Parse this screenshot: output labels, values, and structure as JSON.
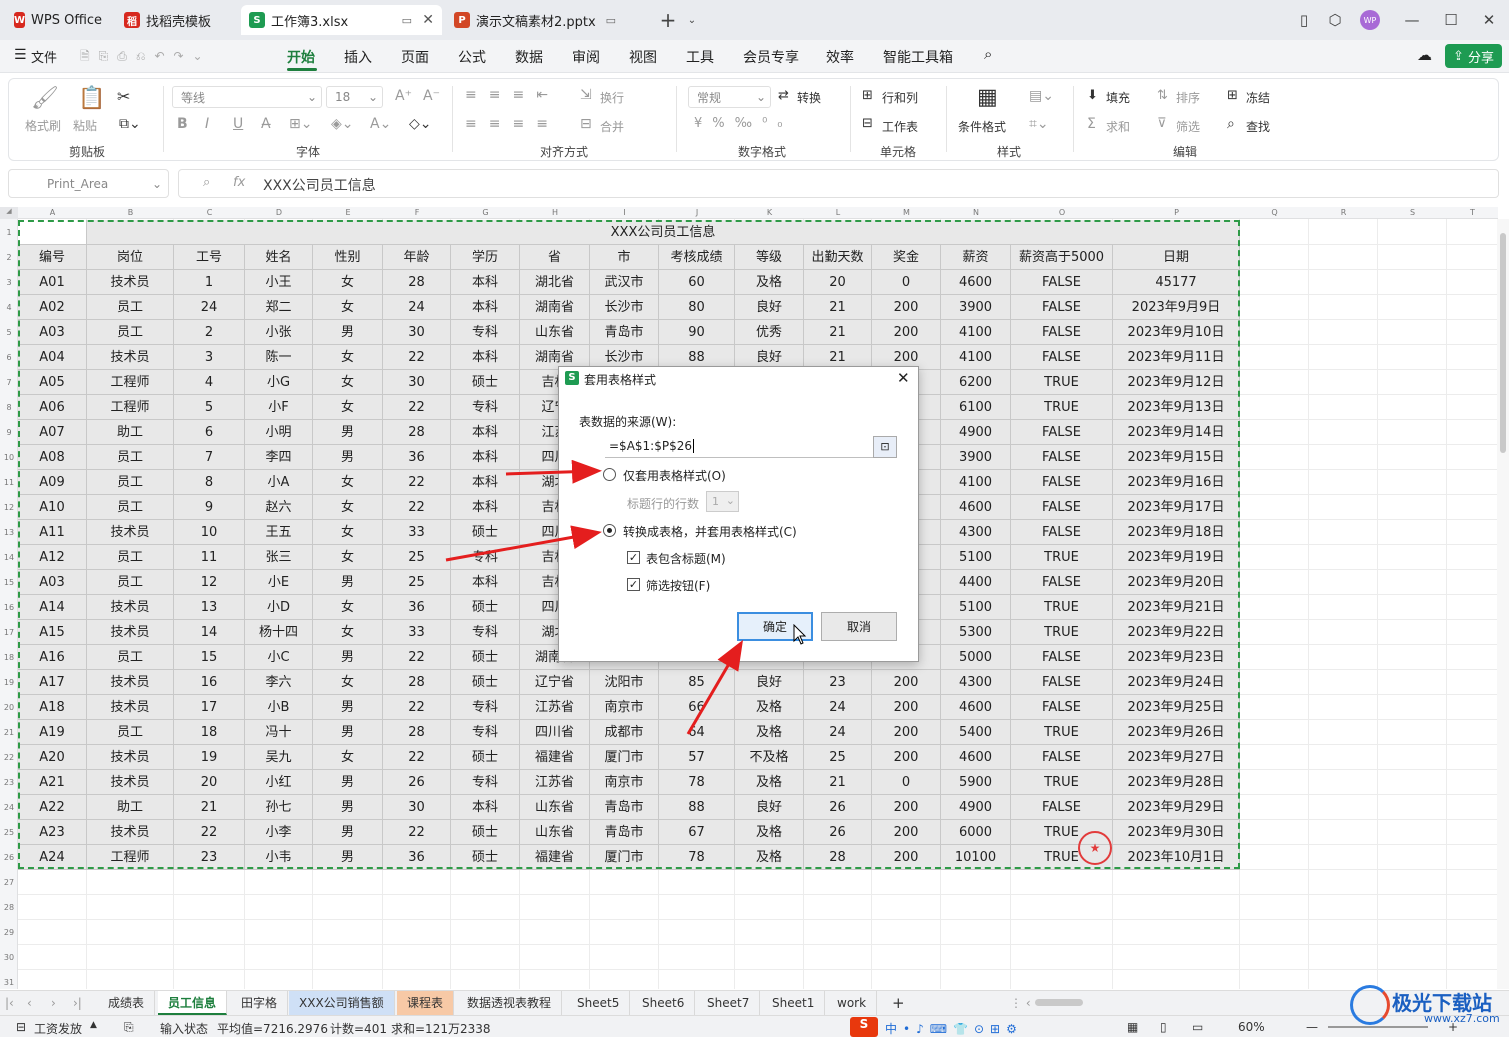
{
  "titlebar": {
    "tabs": [
      {
        "label": "WPS Office",
        "color": "#d7281e",
        "icon": "W"
      },
      {
        "label": "找稻壳模板",
        "color": "#d7281e",
        "icon": "稻"
      },
      {
        "label": "工作簿3.xlsx",
        "color": "#1e9b52",
        "icon": "S"
      },
      {
        "label": "演示文稿素材2.pptx",
        "color": "#d24726",
        "icon": "P"
      }
    ],
    "avatar": "WP"
  },
  "menu": {
    "file": "文件",
    "items": [
      "开始",
      "插入",
      "页面",
      "公式",
      "数据",
      "审阅",
      "视图",
      "工具",
      "会员专享",
      "效率",
      "智能工具箱"
    ],
    "share": "分享"
  },
  "ribbon": {
    "format_painter": "格式刷",
    "paste": "粘贴",
    "clipboard": "剪贴板",
    "font_name": "等线",
    "font_size": "18",
    "font": "字体",
    "wrap": "换行",
    "merge": "合并",
    "align": "对齐方式",
    "number_format": "常规",
    "convert": "转换",
    "number": "数字格式",
    "rowcol": "行和列",
    "worksheet": "工作表",
    "cells": "单元格",
    "cond_format": "条件格式",
    "styles": "样式",
    "fill": "填充",
    "sort": "排序",
    "freeze": "冻结",
    "sum": "求和",
    "filter": "筛选",
    "find": "查找",
    "edit": "编辑"
  },
  "formula": {
    "name_box": "Print_Area",
    "fx": "fx",
    "content": "XXX公司员工信息"
  },
  "columns": [
    "A",
    "B",
    "C",
    "D",
    "E",
    "F",
    "G",
    "H",
    "I",
    "J",
    "K",
    "L",
    "M",
    "N",
    "O",
    "P",
    "Q",
    "R",
    "S",
    "T"
  ],
  "table": {
    "title": "XXX公司员工信息",
    "headers": [
      "编号",
      "岗位",
      "工号",
      "姓名",
      "性别",
      "年龄",
      "学历",
      "省",
      "市",
      "考核成绩",
      "等级",
      "出勤天数",
      "奖金",
      "薪资",
      "薪资高于5000",
      "日期"
    ],
    "rows": [
      [
        "A01",
        "技术员",
        "1",
        "小王",
        "女",
        "28",
        "本科",
        "湖北省",
        "武汉市",
        "60",
        "及格",
        "20",
        "0",
        "4600",
        "FALSE",
        "45177"
      ],
      [
        "A02",
        "员工",
        "24",
        "郑二",
        "女",
        "24",
        "本科",
        "湖南省",
        "长沙市",
        "80",
        "良好",
        "21",
        "200",
        "3900",
        "FALSE",
        "2023年9月9日"
      ],
      [
        "A03",
        "员工",
        "2",
        "小张",
        "男",
        "30",
        "专科",
        "山东省",
        "青岛市",
        "90",
        "优秀",
        "21",
        "200",
        "4100",
        "FALSE",
        "2023年9月10日"
      ],
      [
        "A04",
        "技术员",
        "3",
        "陈一",
        "女",
        "22",
        "本科",
        "湖南省",
        "长沙市",
        "88",
        "良好",
        "21",
        "200",
        "4100",
        "FALSE",
        "2023年9月11日"
      ],
      [
        "A05",
        "工程师",
        "4",
        "小G",
        "女",
        "30",
        "硕士",
        "吉林",
        "",
        "",
        "",
        "",
        "",
        "6200",
        "TRUE",
        "2023年9月12日"
      ],
      [
        "A06",
        "工程师",
        "5",
        "小F",
        "女",
        "22",
        "专科",
        "辽宁",
        "",
        "",
        "",
        "",
        "",
        "6100",
        "TRUE",
        "2023年9月13日"
      ],
      [
        "A07",
        "助工",
        "6",
        "小明",
        "男",
        "28",
        "本科",
        "江苏",
        "",
        "",
        "",
        "",
        "",
        "4900",
        "FALSE",
        "2023年9月14日"
      ],
      [
        "A08",
        "员工",
        "7",
        "李四",
        "男",
        "36",
        "本科",
        "四川",
        "",
        "",
        "",
        "",
        "",
        "3900",
        "FALSE",
        "2023年9月15日"
      ],
      [
        "A09",
        "员工",
        "8",
        "小A",
        "女",
        "22",
        "本科",
        "湖北",
        "",
        "",
        "",
        "",
        "",
        "4100",
        "FALSE",
        "2023年9月16日"
      ],
      [
        "A10",
        "员工",
        "9",
        "赵六",
        "女",
        "22",
        "本科",
        "吉林",
        "",
        "",
        "",
        "",
        "",
        "4600",
        "FALSE",
        "2023年9月17日"
      ],
      [
        "A11",
        "技术员",
        "10",
        "王五",
        "女",
        "33",
        "硕士",
        "四川",
        "",
        "",
        "",
        "",
        "",
        "4300",
        "FALSE",
        "2023年9月18日"
      ],
      [
        "A12",
        "员工",
        "11",
        "张三",
        "女",
        "25",
        "专科",
        "吉林",
        "",
        "",
        "",
        "",
        "",
        "5100",
        "TRUE",
        "2023年9月19日"
      ],
      [
        "A03",
        "员工",
        "12",
        "小E",
        "男",
        "25",
        "本科",
        "吉林",
        "",
        "",
        "",
        "",
        "",
        "4400",
        "FALSE",
        "2023年9月20日"
      ],
      [
        "A14",
        "技术员",
        "13",
        "小D",
        "女",
        "36",
        "硕士",
        "四川",
        "",
        "",
        "",
        "",
        "",
        "5100",
        "TRUE",
        "2023年9月21日"
      ],
      [
        "A15",
        "技术员",
        "14",
        "杨十四",
        "女",
        "33",
        "专科",
        "湖北",
        "",
        "",
        "",
        "",
        "",
        "5300",
        "TRUE",
        "2023年9月22日"
      ],
      [
        "A16",
        "员工",
        "15",
        "小C",
        "男",
        "22",
        "硕士",
        "湖南省",
        "",
        "",
        "",
        "",
        "",
        "5000",
        "FALSE",
        "2023年9月23日"
      ],
      [
        "A17",
        "技术员",
        "16",
        "李六",
        "女",
        "28",
        "硕士",
        "辽宁省",
        "沈阳市",
        "85",
        "良好",
        "23",
        "200",
        "4300",
        "FALSE",
        "2023年9月24日"
      ],
      [
        "A18",
        "技术员",
        "17",
        "小B",
        "男",
        "22",
        "专科",
        "江苏省",
        "南京市",
        "66",
        "及格",
        "24",
        "200",
        "4600",
        "FALSE",
        "2023年9月25日"
      ],
      [
        "A19",
        "员工",
        "18",
        "冯十",
        "男",
        "28",
        "专科",
        "四川省",
        "成都市",
        "64",
        "及格",
        "24",
        "200",
        "5400",
        "TRUE",
        "2023年9月26日"
      ],
      [
        "A20",
        "技术员",
        "19",
        "吴九",
        "女",
        "22",
        "硕士",
        "福建省",
        "厦门市",
        "57",
        "不及格",
        "25",
        "200",
        "4600",
        "FALSE",
        "2023年9月27日"
      ],
      [
        "A21",
        "技术员",
        "20",
        "小红",
        "男",
        "26",
        "专科",
        "江苏省",
        "南京市",
        "78",
        "及格",
        "21",
        "0",
        "5900",
        "TRUE",
        "2023年9月28日"
      ],
      [
        "A22",
        "助工",
        "21",
        "孙七",
        "男",
        "30",
        "本科",
        "山东省",
        "青岛市",
        "88",
        "良好",
        "26",
        "200",
        "4900",
        "FALSE",
        "2023年9月29日"
      ],
      [
        "A23",
        "技术员",
        "22",
        "小李",
        "男",
        "22",
        "硕士",
        "山东省",
        "青岛市",
        "67",
        "及格",
        "26",
        "200",
        "6000",
        "TRUE",
        "2023年9月30日"
      ],
      [
        "A24",
        "工程师",
        "23",
        "小韦",
        "男",
        "36",
        "硕士",
        "福建省",
        "厦门市",
        "78",
        "及格",
        "28",
        "200",
        "10100",
        "TRUE",
        "2023年10月1日"
      ]
    ]
  },
  "dialog": {
    "title": "套用表格样式",
    "source_label": "表数据的来源(W):",
    "source_value": "=$A$1:$P$26",
    "option1": "仅套用表格样式(O)",
    "header_rows_label": "标题行的行数",
    "header_rows_value": "1",
    "option2": "转换成表格，并套用表格样式(C)",
    "check1": "表包含标题(M)",
    "check2": "筛选按钮(F)",
    "ok": "确定",
    "cancel": "取消"
  },
  "sheet_tabs": [
    "成绩表",
    "员工信息",
    "田字格",
    "XXX公司销售额",
    "课程表",
    "数据透视表教程",
    "Sheet5",
    "Sheet6",
    "Sheet7",
    "Sheet1",
    "work"
  ],
  "active_sheet": "员工信息",
  "status": {
    "sheet_name": "工资发放",
    "input_state": "输入状态",
    "average": "平均值=7216.2976",
    "count": "计数=401",
    "sum": "求和=121万2338",
    "zoom": "60%"
  },
  "watermark": "极光下载站",
  "watermark_url": "www.xz7.com"
}
